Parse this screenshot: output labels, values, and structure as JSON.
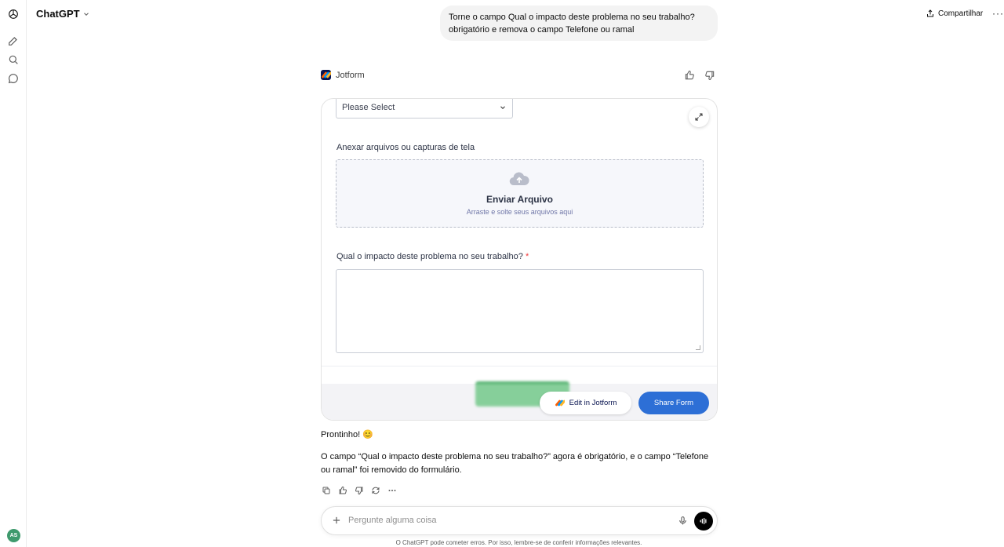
{
  "header": {
    "app_title": "ChatGPT",
    "share_label": "Compartilhar",
    "more_label": "···"
  },
  "sidebar": {
    "items": [
      {
        "icon": "new-chat-icon"
      },
      {
        "icon": "search-icon"
      },
      {
        "icon": "chat-bubble-icon"
      }
    ],
    "avatar_initials": "AS"
  },
  "user_message": "Torne o campo Qual o impacto deste problema no seu trabalho? obrigatório e remova o campo Telefone ou ramal",
  "tool": {
    "name": "Jotform"
  },
  "form": {
    "select_value": "Please Select",
    "attach_label": "Anexar arquivos ou capturas de tela",
    "upload_title": "Enviar Arquivo",
    "upload_subtitle": "Arraste e solte seus arquivos aqui",
    "impact_label": "Qual o impacto deste problema no seu trabalho?",
    "required_mark": "*",
    "edit_button": "Edit in Jotform",
    "share_button": "Share Form"
  },
  "assistant": {
    "line1": "Prontinho! 😊",
    "line2": "O campo “Qual o impacto deste problema no seu trabalho?” agora é obrigatório, e o campo “Telefone ou ramal” foi removido do formulário."
  },
  "composer": {
    "placeholder": "Pergunte alguma coisa"
  },
  "disclaimer": "O ChatGPT pode cometer erros. Por isso, lembre-se de conferir informações relevantes.",
  "colors": {
    "share_button": "#2d6fd6",
    "required": "#f23a3c",
    "avatar": "#3f9a6d"
  }
}
